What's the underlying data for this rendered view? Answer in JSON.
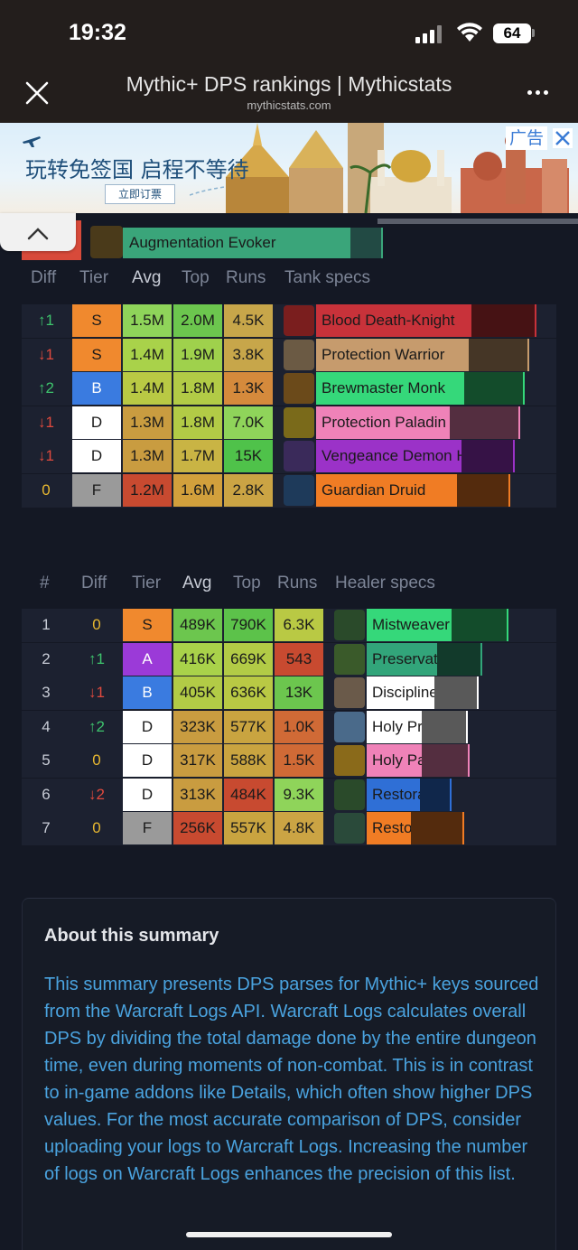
{
  "status": {
    "time": "19:32",
    "battery": "64"
  },
  "browser": {
    "title": "Mythic+ DPS rankings | Mythicstats",
    "url": "mythicstats.com"
  },
  "ad": {
    "headline": "玩转免签国 启程不等待",
    "button": "立即订票",
    "label": "广告"
  },
  "evoker": {
    "label": "Augmentation Evoker",
    "color": "#3aa57a"
  },
  "tank": {
    "headers": [
      "Diff",
      "Tier",
      "Avg",
      "Top",
      "Runs",
      "Tank specs"
    ],
    "rows": [
      {
        "diff": "↑1",
        "diff_color": "#3ec46d",
        "tier": "S",
        "tier_color": "#f0892e",
        "avg": "1.5M",
        "avg_color": "#8fd45a",
        "top": "2.0M",
        "top_color": "#6cc64e",
        "runs": "4.5K",
        "runs_color": "#c7a64a",
        "spec": "Blood Death-Knight",
        "spec_color": "#c8323a",
        "icon": "blood-dk-icon",
        "icon_color": "#7a1e1e",
        "fill": 0.66,
        "ext": 0.93
      },
      {
        "diff": "↓1",
        "diff_color": "#e04a3e",
        "tier": "S",
        "tier_color": "#f0892e",
        "avg": "1.4M",
        "avg_color": "#a9d24a",
        "top": "1.9M",
        "top_color": "#9fd14c",
        "runs": "3.8K",
        "runs_color": "#c7a64a",
        "spec": "Protection Warrior",
        "spec_color": "#c69b6d",
        "icon": "prot-warrior-icon",
        "icon_color": "#6b5a44",
        "fill": 0.65,
        "ext": 0.9
      },
      {
        "diff": "↑2",
        "diff_color": "#3ec46d",
        "tier": "B",
        "tier_color": "#3a7be0",
        "avg": "1.4M",
        "avg_color": "#b9c944",
        "top": "1.8M",
        "top_color": "#b2cb46",
        "runs": "1.3K",
        "runs_color": "#d58a3c",
        "spec": "Brewmaster Monk",
        "spec_color": "#35d87a",
        "icon": "brewmaster-icon",
        "icon_color": "#6b4a1a",
        "fill": 0.63,
        "ext": 0.88
      },
      {
        "diff": "↓1",
        "diff_color": "#e04a3e",
        "tier": "D",
        "tier_color": "#ffffff",
        "avg": "1.3M",
        "avg_color": "#c99c40",
        "top": "1.8M",
        "top_color": "#b2cb46",
        "runs": "7.0K",
        "runs_color": "#8fd45a",
        "spec": "Protection Paladin",
        "spec_color": "#ef82b8",
        "icon": "prot-paladin-icon",
        "icon_color": "#7a6a1a",
        "fill": 0.57,
        "ext": 0.86
      },
      {
        "diff": "↓1",
        "diff_color": "#e04a3e",
        "tier": "D",
        "tier_color": "#ffffff",
        "avg": "1.3M",
        "avg_color": "#c99c40",
        "top": "1.7M",
        "top_color": "#c9b444",
        "runs": "15K",
        "runs_color": "#4fc24a",
        "spec": "Vengeance Demon Hunter",
        "spec_color": "#9b32c8",
        "icon": "vengeance-icon",
        "icon_color": "#3a2a5a",
        "fill": 0.62,
        "ext": 0.84
      },
      {
        "diff": "0",
        "diff_color": "#e8b830",
        "tier": "F",
        "tier_color": "#9a9a9a",
        "avg": "1.2M",
        "avg_color": "#c84a30",
        "top": "1.6M",
        "top_color": "#d2a03c",
        "runs": "2.8K",
        "runs_color": "#cba444",
        "spec": "Guardian Druid",
        "spec_color": "#f07c24",
        "icon": "guardian-icon",
        "icon_color": "#1e3a5a",
        "fill": 0.6,
        "ext": 0.82
      }
    ]
  },
  "healer": {
    "headers": [
      "#",
      "Diff",
      "Tier",
      "Avg",
      "Top",
      "Runs",
      "Healer specs"
    ],
    "rows": [
      {
        "rank": "1",
        "diff": "0",
        "diff_color": "#e8b830",
        "tier": "S",
        "tier_color": "#f0892e",
        "avg": "489K",
        "avg_color": "#6cc64e",
        "top": "790K",
        "top_color": "#5cc24a",
        "runs": "6.3K",
        "runs_color": "#b9c944",
        "spec": "Mistweaver Monk",
        "spec_color": "#35d87a",
        "icon": "mistweaver-icon",
        "icon_color": "#2a4a2a",
        "fill": 0.46,
        "ext": 0.76
      },
      {
        "rank": "2",
        "diff": "↑1",
        "diff_color": "#3ec46d",
        "tier": "A",
        "tier_color": "#9b3ad8",
        "avg": "416K",
        "avg_color": "#a9d24a",
        "top": "669K",
        "top_color": "#b2cb46",
        "runs": "543",
        "runs_color": "#c84a30",
        "spec": "Preservation Evoker",
        "spec_color": "#32a57a",
        "icon": "preservation-icon",
        "icon_color": "#3a5a2a",
        "fill": 0.38,
        "ext": 0.62
      },
      {
        "rank": "3",
        "diff": "↓1",
        "diff_color": "#e04a3e",
        "tier": "B",
        "tier_color": "#3a7be0",
        "avg": "405K",
        "avg_color": "#b2cb46",
        "top": "636K",
        "top_color": "#b9c944",
        "runs": "13K",
        "runs_color": "#6cc64e",
        "spec": "Discipline Priest",
        "spec_color": "#ffffff",
        "icon": "discipline-icon",
        "icon_color": "#6a5a4a",
        "fill": 0.37,
        "ext": 0.6
      },
      {
        "rank": "4",
        "diff": "↑2",
        "diff_color": "#3ec46d",
        "tier": "D",
        "tier_color": "#ffffff",
        "avg": "323K",
        "avg_color": "#c99c40",
        "top": "577K",
        "top_color": "#c9a440",
        "runs": "1.0K",
        "runs_color": "#d06a36",
        "spec": "Holy Priest",
        "spec_color": "#ffffff",
        "icon": "holy-priest-icon",
        "icon_color": "#4a6a8a",
        "fill": 0.3,
        "ext": 0.54
      },
      {
        "rank": "5",
        "diff": "0",
        "diff_color": "#e8b830",
        "tier": "D",
        "tier_color": "#ffffff",
        "avg": "317K",
        "avg_color": "#c99c40",
        "top": "588K",
        "top_color": "#c9a440",
        "runs": "1.5K",
        "runs_color": "#d06a36",
        "spec": "Holy Paladin",
        "spec_color": "#ef82b8",
        "icon": "holy-paladin-icon",
        "icon_color": "#8a6a1a",
        "fill": 0.3,
        "ext": 0.55
      },
      {
        "rank": "6",
        "diff": "↓2",
        "diff_color": "#e04a3e",
        "tier": "D",
        "tier_color": "#ffffff",
        "avg": "313K",
        "avg_color": "#c99c40",
        "top": "484K",
        "top_color": "#c84a30",
        "runs": "9.3K",
        "runs_color": "#8fd45a",
        "spec": "Restoration Shaman",
        "spec_color": "#2f6fd6",
        "icon": "resto-shaman-icon",
        "icon_color": "#2a4a2a",
        "fill": 0.29,
        "ext": 0.45
      },
      {
        "rank": "7",
        "diff": "0",
        "diff_color": "#e8b830",
        "tier": "F",
        "tier_color": "#9a9a9a",
        "avg": "256K",
        "avg_color": "#c84a30",
        "top": "557K",
        "top_color": "#c9a440",
        "runs": "4.8K",
        "runs_color": "#cba444",
        "spec": "Restoration Druid",
        "spec_color": "#f07c24",
        "icon": "resto-druid-icon",
        "icon_color": "#2a4a3a",
        "fill": 0.24,
        "ext": 0.52
      }
    ]
  },
  "about": {
    "title": "About this summary",
    "body": "This summary presents DPS parses for Mythic+ keys sourced from the Warcraft Logs API. Warcraft Logs calculates overall DPS by dividing the total damage done by the entire dungeon time, even during moments of non-combat. This is in contrast to in-game addons like Details, which often show higher DPS values. For the most accurate comparison of DPS, consider uploading your logs to Warcraft Logs. Increasing the number of logs on Warcraft Logs enhances the precision of this list."
  }
}
